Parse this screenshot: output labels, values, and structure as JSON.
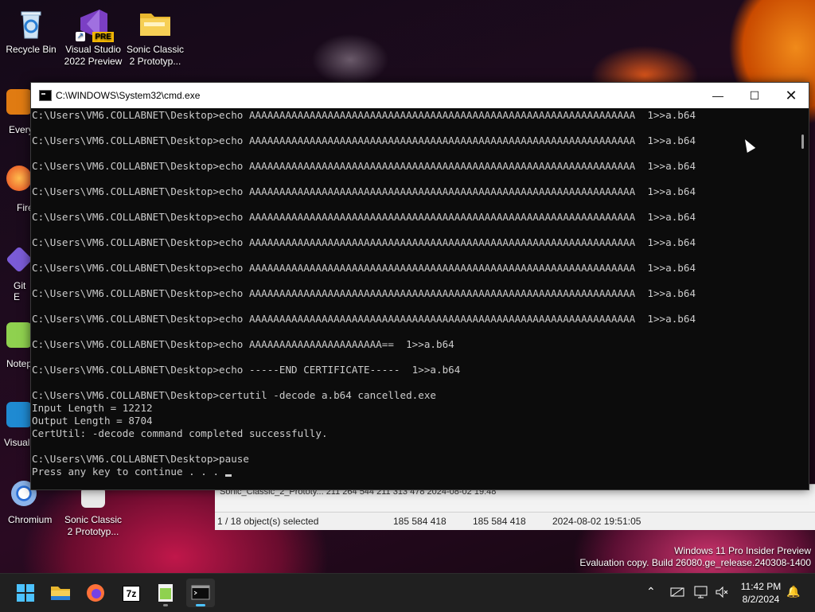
{
  "desktop": {
    "icons": [
      {
        "label": "Recycle Bin",
        "icon": "recycle-bin-icon"
      },
      {
        "label": "Visual Studio 2022 Preview",
        "icon": "visual-studio-icon",
        "badge": "PRE"
      },
      {
        "label": "Sonic Classic 2 Prototyp...",
        "icon": "folder-icon"
      }
    ],
    "side_labels": [
      "Every",
      "Fire",
      "Git E",
      "Notep",
      "Visual",
      "Chromium",
      "Sonic Classic 2 Prototyp..."
    ]
  },
  "cmd": {
    "title": "C:\\WINDOWS\\System32\\cmd.exe",
    "lines": [
      "C:\\Users\\VM6.COLLABNET\\Desktop>echo AAAAAAAAAAAAAAAAAAAAAAAAAAAAAAAAAAAAAAAAAAAAAAAAAAAAAAAAAAAAAAAA  1>>a.b64",
      "",
      "C:\\Users\\VM6.COLLABNET\\Desktop>echo AAAAAAAAAAAAAAAAAAAAAAAAAAAAAAAAAAAAAAAAAAAAAAAAAAAAAAAAAAAAAAAA  1>>a.b64",
      "",
      "C:\\Users\\VM6.COLLABNET\\Desktop>echo AAAAAAAAAAAAAAAAAAAAAAAAAAAAAAAAAAAAAAAAAAAAAAAAAAAAAAAAAAAAAAAA  1>>a.b64",
      "",
      "C:\\Users\\VM6.COLLABNET\\Desktop>echo AAAAAAAAAAAAAAAAAAAAAAAAAAAAAAAAAAAAAAAAAAAAAAAAAAAAAAAAAAAAAAAA  1>>a.b64",
      "",
      "C:\\Users\\VM6.COLLABNET\\Desktop>echo AAAAAAAAAAAAAAAAAAAAAAAAAAAAAAAAAAAAAAAAAAAAAAAAAAAAAAAAAAAAAAAA  1>>a.b64",
      "",
      "C:\\Users\\VM6.COLLABNET\\Desktop>echo AAAAAAAAAAAAAAAAAAAAAAAAAAAAAAAAAAAAAAAAAAAAAAAAAAAAAAAAAAAAAAAA  1>>a.b64",
      "",
      "C:\\Users\\VM6.COLLABNET\\Desktop>echo AAAAAAAAAAAAAAAAAAAAAAAAAAAAAAAAAAAAAAAAAAAAAAAAAAAAAAAAAAAAAAAA  1>>a.b64",
      "",
      "C:\\Users\\VM6.COLLABNET\\Desktop>echo AAAAAAAAAAAAAAAAAAAAAAAAAAAAAAAAAAAAAAAAAAAAAAAAAAAAAAAAAAAAAAAA  1>>a.b64",
      "",
      "C:\\Users\\VM6.COLLABNET\\Desktop>echo AAAAAAAAAAAAAAAAAAAAAAAAAAAAAAAAAAAAAAAAAAAAAAAAAAAAAAAAAAAAAAAA  1>>a.b64",
      "",
      "C:\\Users\\VM6.COLLABNET\\Desktop>echo AAAAAAAAAAAAAAAAAAAAAA==  1>>a.b64",
      "",
      "C:\\Users\\VM6.COLLABNET\\Desktop>echo -----END CERTIFICATE-----  1>>a.b64",
      "",
      "C:\\Users\\VM6.COLLABNET\\Desktop>certutil -decode a.b64 cancelled.exe",
      "Input Length = 12212",
      "Output Length = 8704",
      "CertUtil: -decode command completed successfully.",
      "",
      "C:\\Users\\VM6.COLLABNET\\Desktop>pause",
      "Press any key to continue . . . "
    ]
  },
  "explorer": {
    "partial_row": "Sonic_Classic_2_Prototy...     211 264 544          211 313 478     2024-08-02 19:48",
    "status": {
      "selected": "1 / 18 object(s) selected",
      "size1": "185 584 418",
      "size2": "185 584 418",
      "date": "2024-08-02 19:51:05"
    }
  },
  "watermark": {
    "line1": "Windows 11 Pro Insider Preview",
    "line2": "Evaluation copy. Build 26080.ge_release.240308-1400"
  },
  "taskbar": {
    "apps": [
      "start-icon",
      "file-explorer-icon",
      "firefox-icon",
      "7zip-icon",
      "notepad-plus-plus-icon",
      "terminal-icon"
    ],
    "seven_zip_label": "7z",
    "time": "11:42 PM",
    "date": "8/2/2024"
  }
}
